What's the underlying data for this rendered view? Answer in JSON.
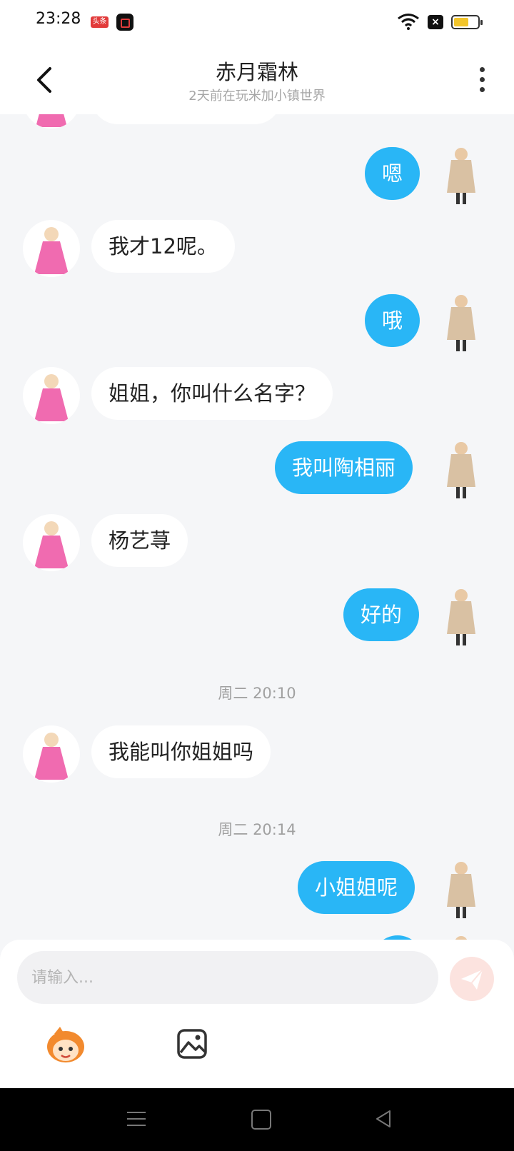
{
  "status_bar": {
    "time": "23:28",
    "badge_toutiao": "头条"
  },
  "header": {
    "title": "赤月霜林",
    "subtitle": "2天前在玩米加小镇世界"
  },
  "messages": [
    {
      "text": "嗯"
    },
    {
      "text": "我才12呢。"
    },
    {
      "text": "哦"
    },
    {
      "text": "姐姐，你叫什么名字？"
    },
    {
      "text": "我叫陶相丽"
    },
    {
      "text": "杨艺荨"
    },
    {
      "text": "好的"
    },
    {
      "text": "我能叫你姐姐吗"
    },
    {
      "text": "小姐姐呢"
    }
  ],
  "timestamps": [
    "周二 20:10",
    "周二 20:14"
  ],
  "composer": {
    "placeholder": "请输入..."
  },
  "colors": {
    "outgoing_bubble": "#29b6f6",
    "incoming_bubble": "#ffffff",
    "send_button": "#fce3df"
  },
  "icons": [
    "back-icon",
    "more-icon",
    "send-icon",
    "emoji-mascot-icon",
    "image-icon",
    "wifi-icon",
    "battery-icon"
  ]
}
